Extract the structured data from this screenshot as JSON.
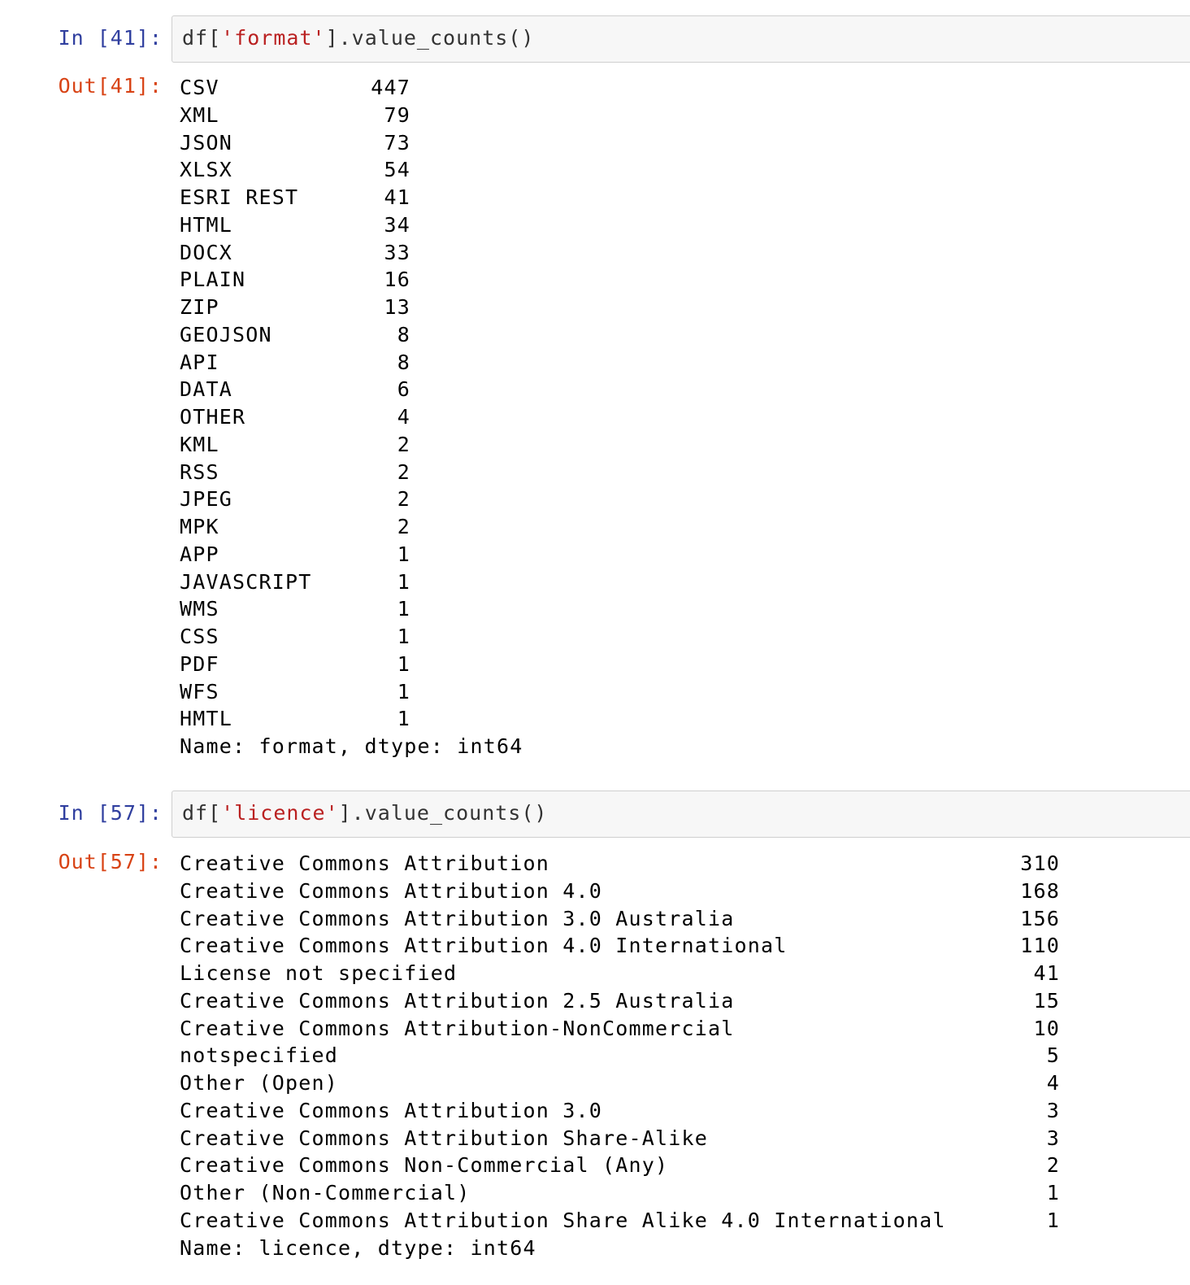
{
  "cells": [
    {
      "in_prompt": "In [41]:",
      "code_prefix": "df[",
      "code_string": "'format'",
      "code_suffix": "].value_counts()",
      "out_prompt": "Out[41]:",
      "rows": [
        {
          "label": "CSV",
          "count": "447"
        },
        {
          "label": "XML",
          "count": "79"
        },
        {
          "label": "JSON",
          "count": "73"
        },
        {
          "label": "XLSX",
          "count": "54"
        },
        {
          "label": "ESRI REST",
          "count": "41"
        },
        {
          "label": "HTML",
          "count": "34"
        },
        {
          "label": "DOCX",
          "count": "33"
        },
        {
          "label": "PLAIN",
          "count": "16"
        },
        {
          "label": "ZIP",
          "count": "13"
        },
        {
          "label": "GEOJSON",
          "count": "8"
        },
        {
          "label": "API",
          "count": "8"
        },
        {
          "label": "DATA",
          "count": "6"
        },
        {
          "label": "OTHER",
          "count": "4"
        },
        {
          "label": "KML",
          "count": "2"
        },
        {
          "label": "RSS",
          "count": "2"
        },
        {
          "label": "JPEG",
          "count": "2"
        },
        {
          "label": "MPK",
          "count": "2"
        },
        {
          "label": "APP",
          "count": "1"
        },
        {
          "label": "JAVASCRIPT",
          "count": "1"
        },
        {
          "label": "WMS",
          "count": "1"
        },
        {
          "label": "CSS",
          "count": "1"
        },
        {
          "label": "PDF",
          "count": "1"
        },
        {
          "label": "WFS",
          "count": "1"
        },
        {
          "label": "HMTL",
          "count": "1"
        }
      ],
      "footer": "Name: format, dtype: int64"
    },
    {
      "in_prompt": "In [57]:",
      "code_prefix": "df[",
      "code_string": "'licence'",
      "code_suffix": "].value_counts()",
      "out_prompt": "Out[57]:",
      "rows": [
        {
          "label": "Creative Commons Attribution",
          "count": "310"
        },
        {
          "label": "Creative Commons Attribution 4.0",
          "count": "168"
        },
        {
          "label": "Creative Commons Attribution 3.0 Australia",
          "count": "156"
        },
        {
          "label": "Creative Commons Attribution 4.0 International",
          "count": "110"
        },
        {
          "label": "License not specified",
          "count": "41"
        },
        {
          "label": "Creative Commons Attribution 2.5 Australia",
          "count": "15"
        },
        {
          "label": "Creative Commons Attribution-NonCommercial",
          "count": "10"
        },
        {
          "label": "notspecified",
          "count": "5"
        },
        {
          "label": "Other (Open)",
          "count": "4"
        },
        {
          "label": "Creative Commons Attribution 3.0",
          "count": "3"
        },
        {
          "label": "Creative Commons Attribution Share-Alike",
          "count": "3"
        },
        {
          "label": "Creative Commons Non-Commercial (Any)",
          "count": "2"
        },
        {
          "label": "Other (Non-Commercial)",
          "count": "1"
        },
        {
          "label": "Creative Commons Attribution Share Alike 4.0 International",
          "count": "1"
        }
      ],
      "footer": "Name: licence, dtype: int64"
    }
  ],
  "colors": {
    "in_prompt": "#303f9f",
    "out_prompt": "#d84315",
    "string_literal": "#ba2121",
    "input_background": "#f7f7f7"
  }
}
